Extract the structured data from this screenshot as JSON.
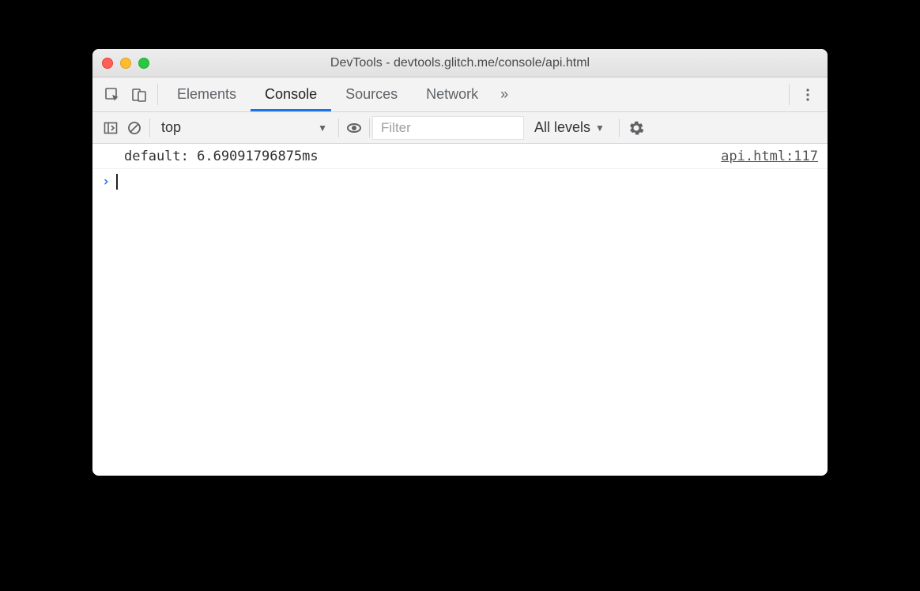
{
  "window": {
    "title": "DevTools - devtools.glitch.me/console/api.html"
  },
  "tabs": {
    "items": [
      "Elements",
      "Console",
      "Sources",
      "Network"
    ],
    "active": "Console",
    "more_glyph": "»"
  },
  "filterbar": {
    "context": "top",
    "filter_placeholder": "Filter",
    "levels_label": "All levels"
  },
  "console": {
    "log_message": "default: 6.69091796875ms",
    "log_source": "api.html:117",
    "prompt_glyph": "›"
  }
}
